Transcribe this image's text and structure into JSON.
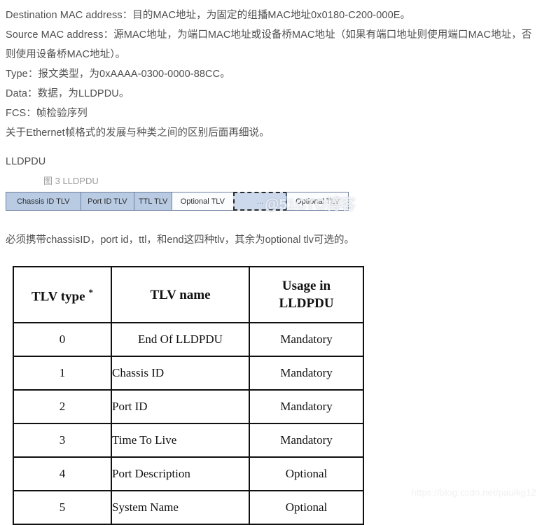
{
  "document": {
    "paragraphs": [
      "Destination MAC address：目的MAC地址，为固定的组播MAC地址0x0180-C200-000E。",
      "Source MAC address：源MAC地址，为端口MAC地址或设备桥MAC地址（如果有端口地址则使用端口MAC地址，否则使用设备桥MAC地址）。",
      "Type：报文类型，为0xAAAA-0300-0000-88CC。",
      "Data：数据，为LLDPDU。",
      "FCS：帧检验序列",
      "关于Ethernet帧格式的发展与种类之间的区别后面再细说。"
    ],
    "section_heading": "LLDPDU",
    "figure_caption": "图 3 LLDPDU",
    "note": "必须携带chassisID，port id，ttl，和end这四种tlv，其余为optional tlv可选的。"
  },
  "diagram": {
    "name": "lldpdu-frame-diagram",
    "cells": [
      {
        "label": "Chassis ID TLV",
        "style": "filled"
      },
      {
        "label": "Port ID TLV",
        "style": "filled"
      },
      {
        "label": "TTL TLV",
        "style": "filled"
      },
      {
        "label": "Optional TLV",
        "style": "light"
      },
      {
        "label": "...",
        "style": "dashed"
      },
      {
        "label": "Optional TLV",
        "style": "light"
      }
    ],
    "colors": {
      "cell_fill": "#b9cbe3",
      "cell_light_fill": "#fbfcfe",
      "cell_border": "#6f7f9f",
      "dashed_border": "#2a2a2a",
      "dashed_fill": "#ccd9ec"
    }
  },
  "table": {
    "name": "tlv-type-table",
    "headers": [
      "TLV type",
      "TLV name",
      "Usage in LLDPDU"
    ],
    "header_type_superscript": "*",
    "rows": [
      {
        "type": "0",
        "name": "End Of LLDPDU",
        "usage": "Mandatory",
        "name_align": "center"
      },
      {
        "type": "1",
        "name": "Chassis ID",
        "usage": "Mandatory",
        "name_align": "left"
      },
      {
        "type": "2",
        "name": "Port ID",
        "usage": "Mandatory",
        "name_align": "left"
      },
      {
        "type": "3",
        "name": "Time To Live",
        "usage": "Mandatory",
        "name_align": "left"
      },
      {
        "type": "4",
        "name": "Port Description",
        "usage": "Optional",
        "name_align": "left"
      },
      {
        "type": "5",
        "name": "System Name",
        "usage": "Optional",
        "name_align": "left"
      }
    ]
  },
  "watermarks": {
    "diagram_overlay": "@51CTO博客",
    "bottom_url": "https://blog.csdn.net/paulkg12"
  }
}
